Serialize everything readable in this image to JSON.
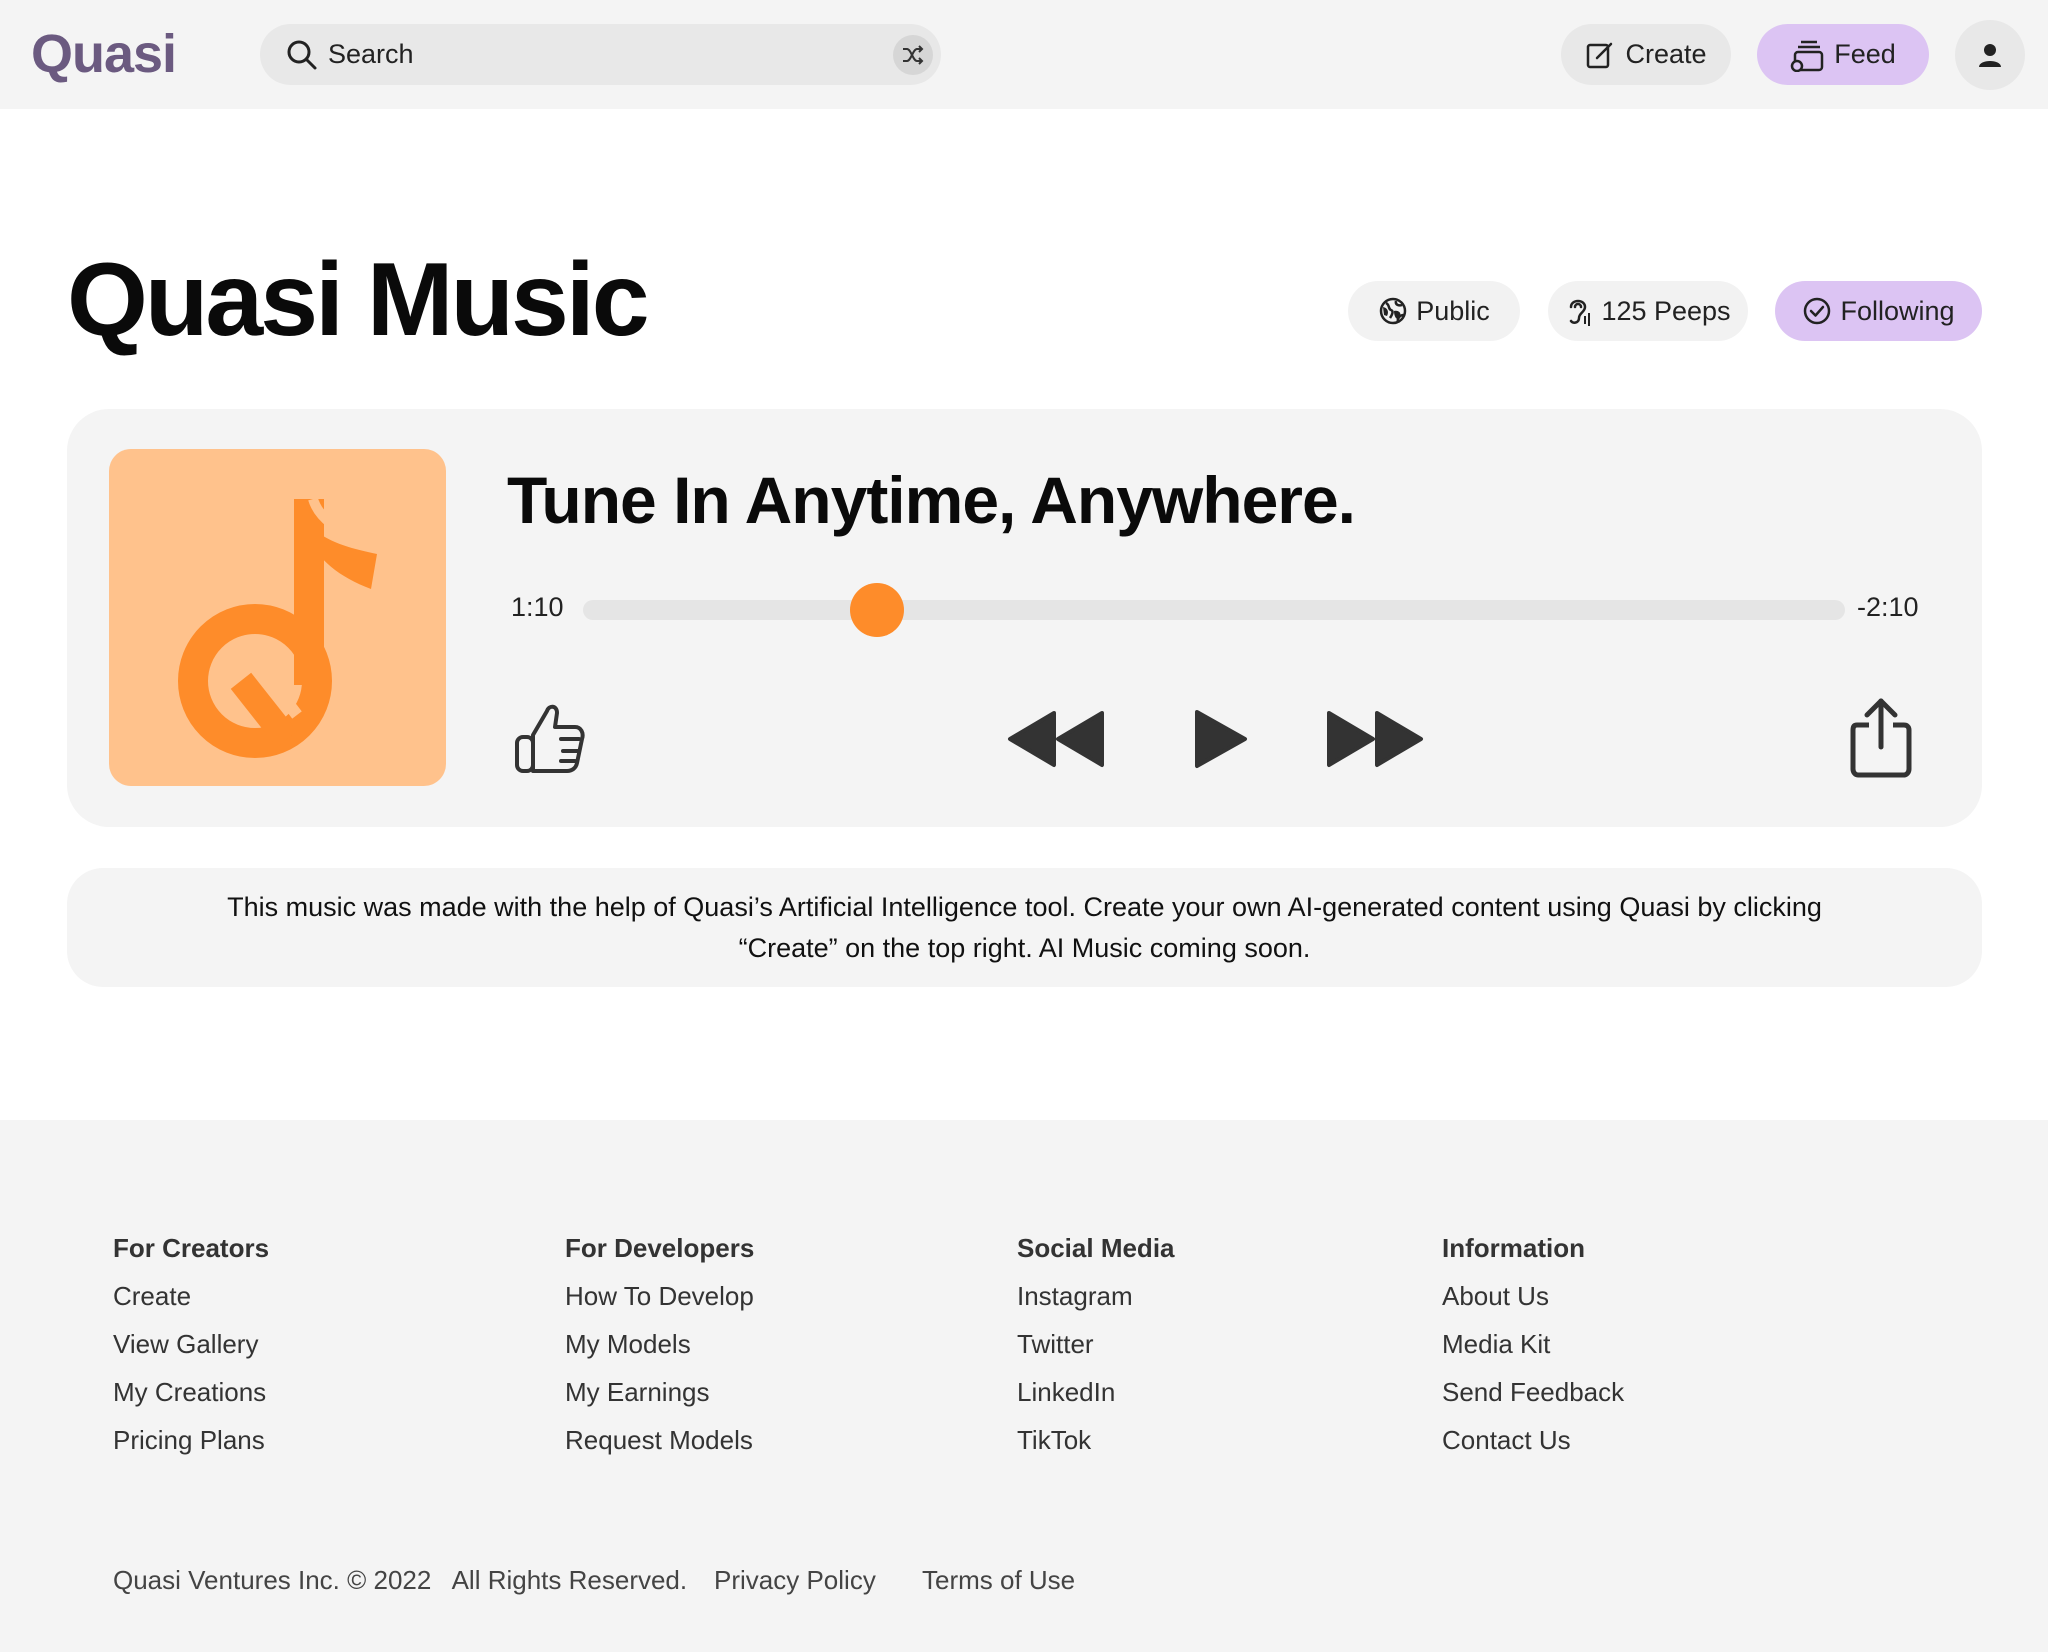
{
  "header": {
    "logo": "Quasi",
    "search": {
      "placeholder": "Search",
      "value": ""
    },
    "create_label": "Create",
    "feed_label": "Feed",
    "colors": {
      "feed_bg": "#dcc4f3",
      "logo": "#6b5a80"
    }
  },
  "page": {
    "title": "Quasi Music",
    "tags": {
      "public": "Public",
      "peeps": "125 Peeps",
      "following": "Following"
    }
  },
  "player": {
    "track_title": "Tune In Anytime, Anywhere.",
    "time_current": "1:10",
    "time_remaining": "-2:10",
    "progress_fraction": 0.233,
    "accent": "#fe8c2a",
    "cover_bg": "#ffc28c",
    "icons": [
      "thumbs-up-icon",
      "rewind-icon",
      "play-icon",
      "fast-forward-icon",
      "share-icon"
    ]
  },
  "notice": {
    "text": "This music was made with the help of Quasi’s Artificial Intelligence tool. Create your own AI-generated content using Quasi by clicking “Create” on the top right. AI Music coming soon."
  },
  "footer": {
    "columns": [
      {
        "heading": "For Creators",
        "links": [
          "Create",
          "View Gallery",
          "My Creations",
          "Pricing Plans"
        ]
      },
      {
        "heading": "For Developers",
        "links": [
          "How To Develop",
          "My Models",
          "My Earnings",
          "Request Models"
        ]
      },
      {
        "heading": "Social Media",
        "links": [
          "Instagram",
          "Twitter",
          "LinkedIn",
          "TikTok"
        ]
      },
      {
        "heading": "Information",
        "links": [
          "About Us",
          "Media Kit",
          "Send Feedback",
          "Contact Us"
        ]
      }
    ],
    "copyright": "Quasi Ventures Inc. © 2022   All Rights Reserved.",
    "privacy": "Privacy Policy",
    "terms": "Terms of Use"
  }
}
